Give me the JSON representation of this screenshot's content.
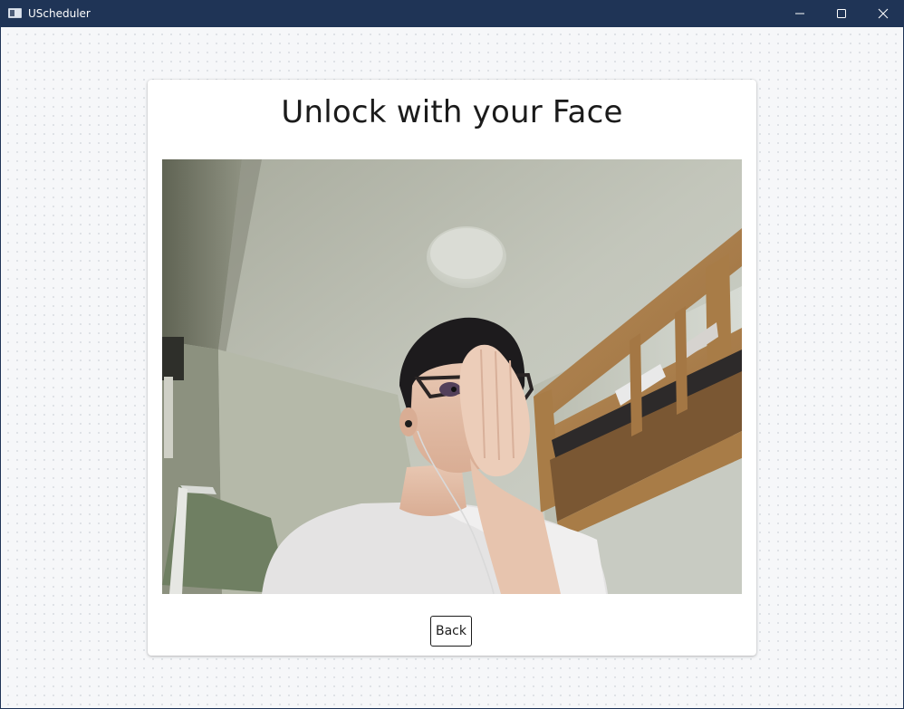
{
  "window": {
    "title": "UScheduler",
    "controls": {
      "minimize": "minimize-icon",
      "maximize": "maximize-icon",
      "close": "close-icon"
    }
  },
  "page": {
    "heading": "Unlock with your Face",
    "camera_feed": "webcam-preview",
    "back_label": "Back"
  },
  "colors": {
    "titlebar": "#1f3456",
    "card": "#ffffff",
    "text": "#1b1b1b"
  }
}
